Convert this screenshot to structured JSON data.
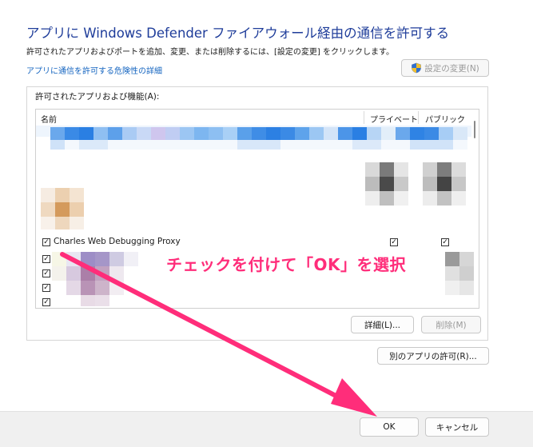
{
  "dialog": {
    "title": "アプリに Windows Defender ファイアウォール経由の通信を許可する",
    "description": "許可されたアプリおよびポートを追加、変更、または削除するには、[設定の変更] をクリックします。",
    "risk_link": "アプリに通信を許可する危険性の詳細",
    "change_settings_label": "設定の変更(N)"
  },
  "allowed_apps": {
    "group_label": "許可されたアプリおよび機能(A):",
    "columns": {
      "name": "名前",
      "private": "プライベート",
      "public": "パブリック"
    },
    "visible_row": {
      "name": "Charles Web Debugging Proxy",
      "enabled": true,
      "private": true,
      "public": true
    },
    "details_label": "詳細(L)...",
    "remove_label": "削除(M)"
  },
  "allow_other_app_label": "別のアプリの許可(R)...",
  "footer": {
    "ok_label": "OK",
    "cancel_label": "キャンセル"
  },
  "annotation": {
    "text": "チェックを付けて「OK」を選択",
    "color": "#ff2d7a"
  }
}
